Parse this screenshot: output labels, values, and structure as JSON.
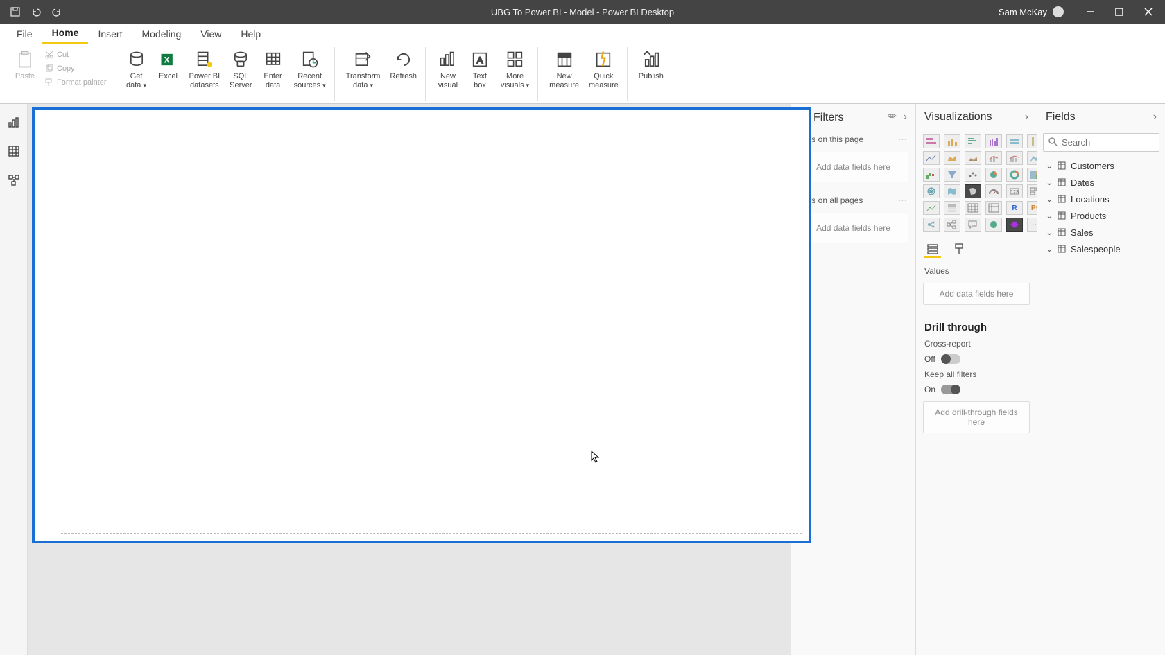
{
  "titlebar": {
    "title": "UBG To Power BI - Model - Power BI Desktop",
    "username": "Sam McKay"
  },
  "menu": {
    "file": "File",
    "home": "Home",
    "insert": "Insert",
    "modeling": "Modeling",
    "view": "View",
    "help": "Help"
  },
  "ribbon": {
    "paste": "Paste",
    "cut": "Cut",
    "copy": "Copy",
    "format_painter": "Format painter",
    "get_data": "Get\ndata",
    "excel": "Excel",
    "pbi_datasets": "Power BI\ndatasets",
    "sql_server": "SQL\nServer",
    "enter_data": "Enter\ndata",
    "recent_sources": "Recent\nsources",
    "transform_data": "Transform\ndata",
    "refresh": "Refresh",
    "new_visual": "New\nvisual",
    "text_box": "Text\nbox",
    "more_visuals": "More\nvisuals",
    "new_measure": "New\nmeasure",
    "quick_measure": "Quick\nmeasure",
    "publish": "Publish"
  },
  "filters": {
    "header": "Filters",
    "on_this_page": "ilters on this page",
    "on_all_pages": "ilters on all pages",
    "add_fields": "Add data fields here"
  },
  "viz": {
    "header": "Visualizations",
    "values": "Values",
    "add_fields": "Add data fields here",
    "drill_through": "Drill through",
    "cross_report": "Cross-report",
    "off": "Off",
    "keep_all_filters": "Keep all filters",
    "on": "On",
    "add_drill": "Add drill-through fields here"
  },
  "fields": {
    "header": "Fields",
    "search_placeholder": "Search",
    "items": {
      "customers": "Customers",
      "dates": "Dates",
      "locations": "Locations",
      "products": "Products",
      "sales": "Sales",
      "salespeople": "Salespeople"
    }
  }
}
